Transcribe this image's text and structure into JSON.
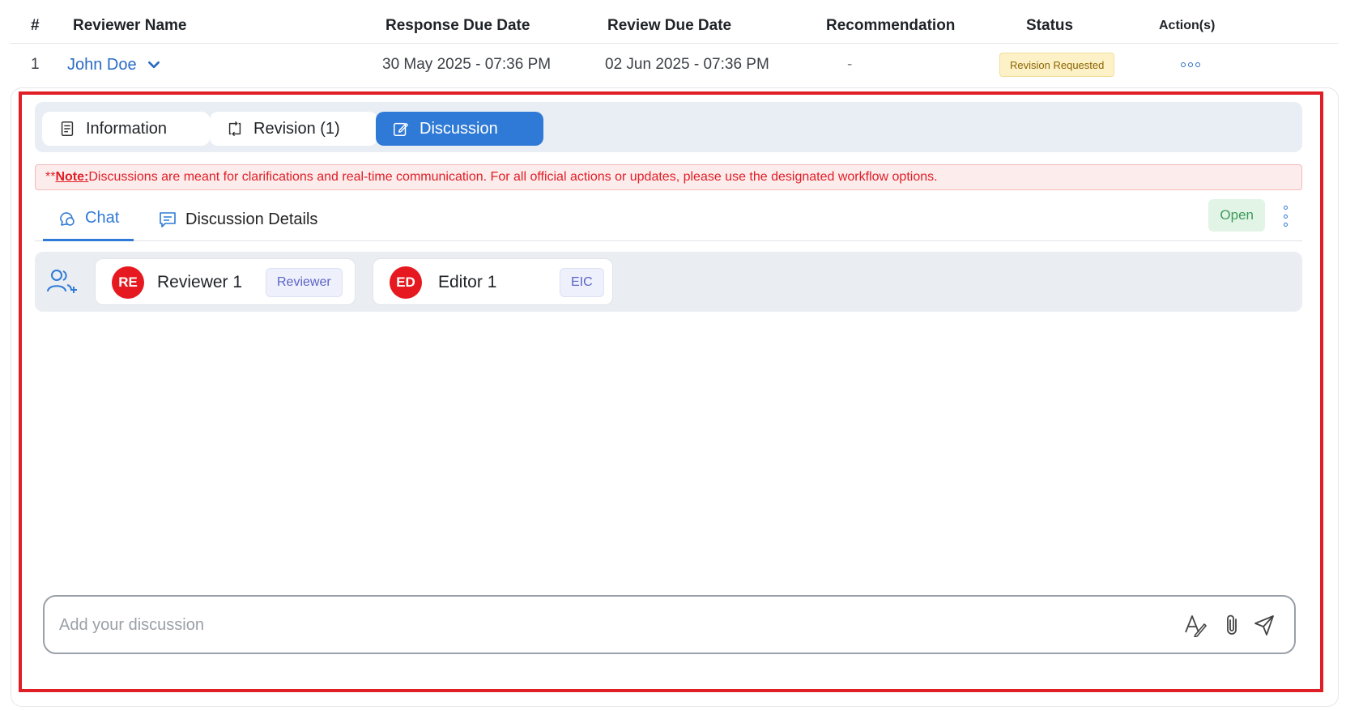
{
  "table": {
    "headers": {
      "num": "#",
      "name": "Reviewer Name",
      "response_due": "Response Due Date",
      "review_due": "Review Due Date",
      "recommendation": "Recommendation",
      "status": "Status",
      "actions": "Action(s)"
    },
    "row": {
      "num": "1",
      "name": "John Doe",
      "response_due": "30 May 2025 - 07:36 PM",
      "review_due": "02 Jun 2025 - 07:36 PM",
      "recommendation": "-",
      "status": "Revision Requested"
    }
  },
  "tabs": [
    {
      "label": "Information",
      "icon": "document-icon"
    },
    {
      "label": "Revision (1)",
      "icon": "revision-icon"
    },
    {
      "label": "Discussion",
      "icon": "edit-icon",
      "active": true
    }
  ],
  "note": {
    "prefix": "**",
    "label": "Note:",
    "text": " Discussions are meant for clarifications and real-time communication. For all official actions or updates, please use the designated workflow options."
  },
  "subtabs": [
    {
      "label": "Chat",
      "icon": "chat-icon",
      "active": true
    },
    {
      "label": "Discussion Details",
      "icon": "details-icon"
    }
  ],
  "discussion_status": "Open",
  "participants": [
    {
      "initials": "RE",
      "name": "Reviewer 1",
      "role": "Reviewer"
    },
    {
      "initials": "ED",
      "name": "Editor 1",
      "role": "EIC"
    }
  ],
  "composer": {
    "placeholder": "Add your discussion"
  },
  "colors": {
    "accent": "#2f7ad6",
    "highlight": "#e01e26",
    "avatar": "#e5191f",
    "status_badge": "#fdf1c8",
    "open_badge": "#e1f4e6"
  }
}
